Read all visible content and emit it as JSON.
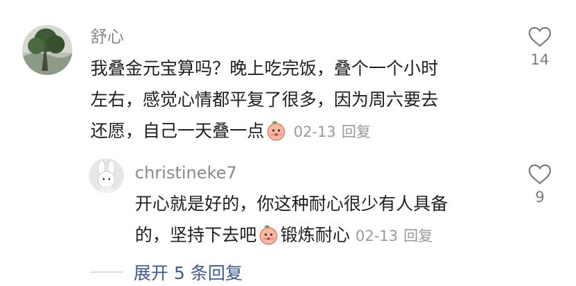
{
  "comment": {
    "username": "舒心",
    "lines": [
      "我叠金元宝算吗？晚上吃完饭，叠个一个小时",
      "左右，感觉心情都平复了很多，因为周六要去",
      "还愿，自己一天叠一点"
    ],
    "emoji": "peach-face-emoji",
    "date": "02-13",
    "reply_label": "回复",
    "like_count": "14"
  },
  "reply": {
    "username": "christineke7",
    "lines": [
      "开心就是好的，你这种耐心很少有人具备",
      "的，坚持下去吧"
    ],
    "text_after_emoji": "锻炼耐心",
    "emoji": "peach-face-emoji",
    "date": "02-13",
    "reply_label": "回复",
    "like_count": "9"
  },
  "expand": {
    "label": "展开 5 条回复"
  },
  "colors": {
    "text": "#1f1f1f",
    "meta": "#9a9a9a",
    "link": "#3c5a8c"
  }
}
